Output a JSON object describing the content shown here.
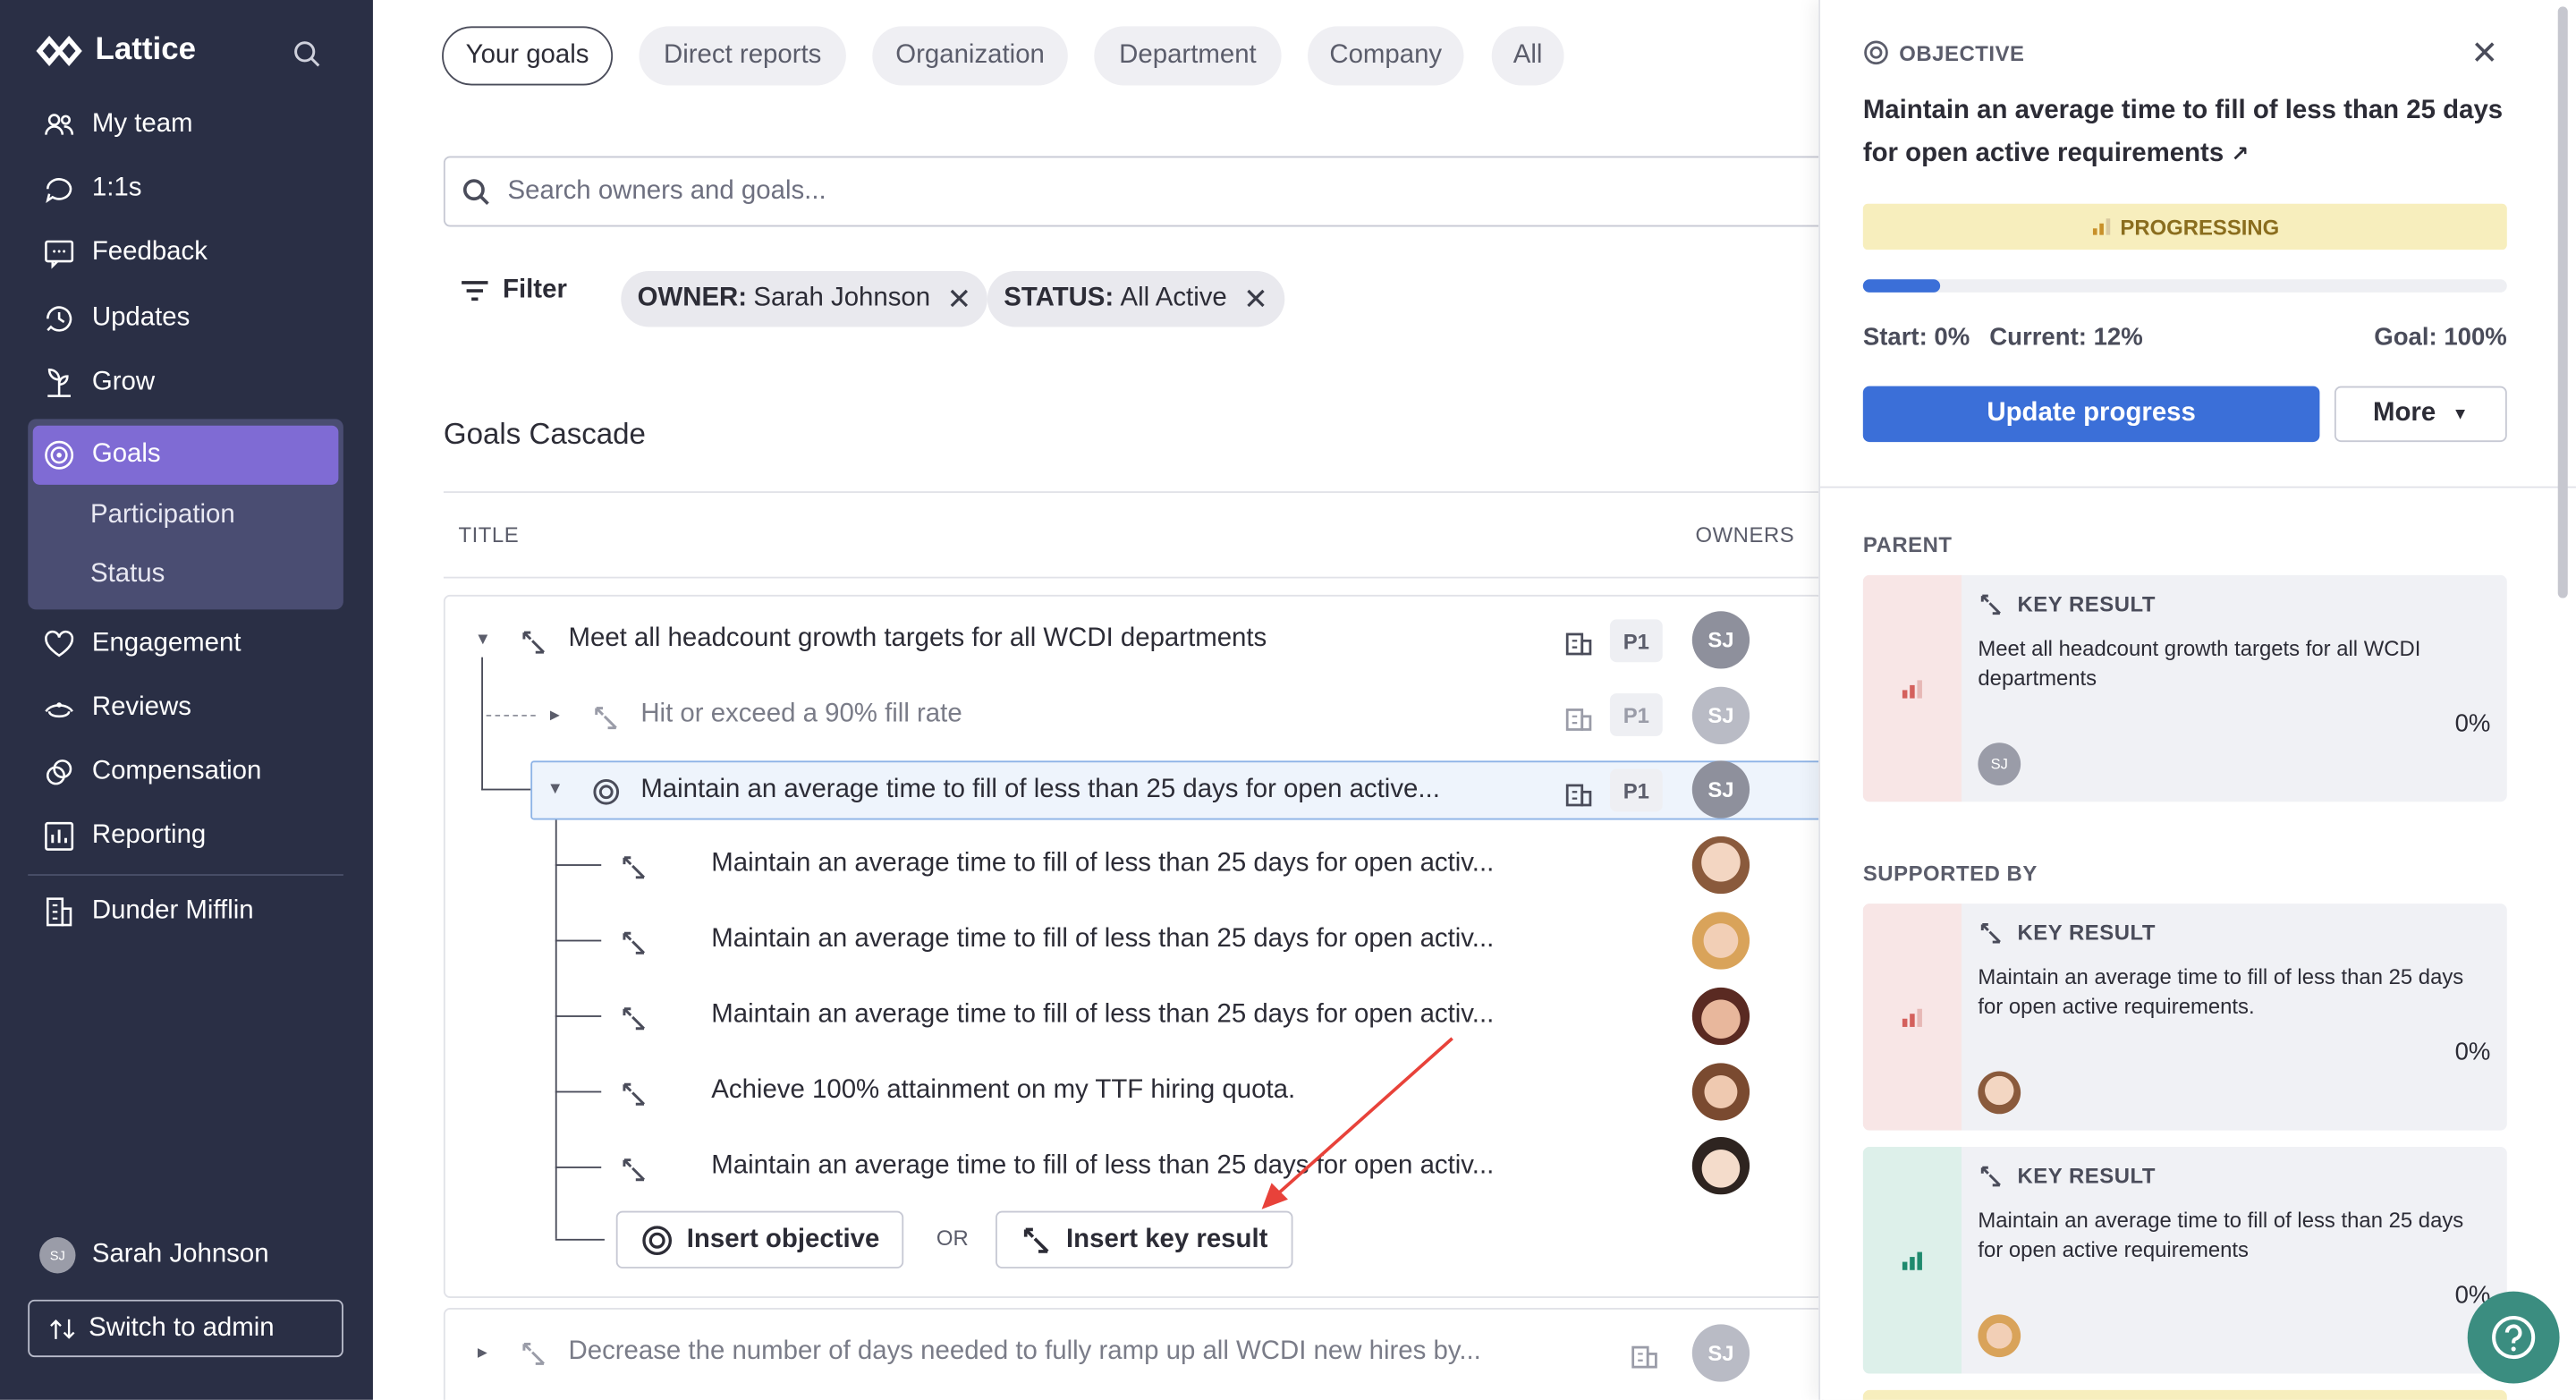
{
  "app": {
    "name": "Lattice"
  },
  "sidebar": {
    "nav": [
      {
        "label": "My team",
        "icon": "team-icon"
      },
      {
        "label": "1:1s",
        "icon": "chat-icon"
      },
      {
        "label": "Feedback",
        "icon": "feedback-icon"
      },
      {
        "label": "Updates",
        "icon": "updates-icon"
      },
      {
        "label": "Grow",
        "icon": "grow-icon"
      },
      {
        "label": "Goals",
        "icon": "target-icon"
      },
      {
        "label": "Engagement",
        "icon": "heart-icon"
      },
      {
        "label": "Reviews",
        "icon": "reviews-icon"
      },
      {
        "label": "Compensation",
        "icon": "compensation-icon"
      },
      {
        "label": "Reporting",
        "icon": "reporting-icon"
      },
      {
        "label": "Dunder Mifflin",
        "icon": "building-icon"
      }
    ],
    "goals_sub": [
      "Participation",
      "Status"
    ],
    "user": {
      "name": "Sarah Johnson",
      "initials": "SJ"
    },
    "switch_label": "Switch to admin"
  },
  "tabs": [
    "Your goals",
    "Direct reports",
    "Organization",
    "Department",
    "Company",
    "All"
  ],
  "search": {
    "placeholder": "Search owners and goals..."
  },
  "filter": {
    "label": "Filter",
    "chips": [
      {
        "key": "OWNER:",
        "value": "Sarah Johnson"
      },
      {
        "key": "STATUS:",
        "value": "All Active"
      }
    ]
  },
  "cascade": {
    "title": "Goals Cascade",
    "columns": {
      "title": "TITLE",
      "owners": "OWNERS"
    },
    "rows": [
      {
        "title": "Meet all headcount growth targets for all WCDI departments",
        "priority": "P1",
        "owner": "SJ"
      },
      {
        "title": "Hit or exceed a 90% fill rate",
        "priority": "P1",
        "owner": "SJ"
      },
      {
        "title": "Maintain an average time to fill of less than 25 days for open active...",
        "priority": "P1",
        "owner": "SJ"
      },
      {
        "title": "Maintain an average time to fill of less than 25 days for open activ..."
      },
      {
        "title": "Maintain an average time to fill of less than 25 days for open activ..."
      },
      {
        "title": "Maintain an average time to fill of less than 25 days for open activ..."
      },
      {
        "title": "Achieve 100% attainment on my TTF hiring quota."
      },
      {
        "title": "Maintain an average time to fill of less than 25 days for open activ..."
      },
      {
        "title": "Decrease the number of days needed to fully ramp up all WCDI new hires by...",
        "owner": "SJ"
      }
    ],
    "insert_objective": "Insert objective",
    "or": "OR",
    "insert_key_result": "Insert key result"
  },
  "panel": {
    "label": "OBJECTIVE",
    "title": "Maintain an average time to fill of less than 25 days for open active requirements",
    "status": "PROGRESSING",
    "progress": 0.12,
    "start": "Start: 0%",
    "current": "Current: 12%",
    "goal": "Goal: 100%",
    "update_label": "Update progress",
    "more_label": "More",
    "parent_label": "PARENT",
    "supported_label": "SUPPORTED BY",
    "parent": {
      "type": "KEY RESULT",
      "text": "Meet all headcount growth targets for all WCDI departments",
      "pct": "0%",
      "owner": "SJ"
    },
    "supported": [
      {
        "type": "KEY RESULT",
        "text": "Maintain an average time to fill of less than 25 days for open active requirements.",
        "pct": "0%"
      },
      {
        "type": "KEY RESULT",
        "text": "Maintain an average time to fill of less than 25 days for open active requirements",
        "pct": "0%"
      }
    ]
  },
  "colors": {
    "sidebar": "#2a2f45",
    "accent": "#7f6bd4",
    "primary": "#3b6fd8",
    "status_bg": "#f7eebd",
    "help": "#3b8d80"
  }
}
